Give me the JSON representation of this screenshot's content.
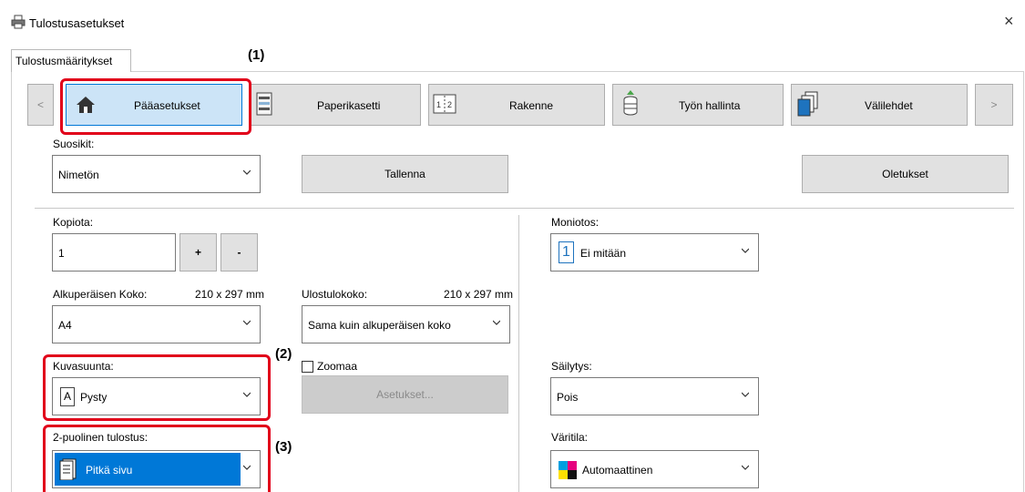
{
  "window": {
    "title": "Tulostusasetukset",
    "close_glyph": "×"
  },
  "tabs": [
    {
      "label": "Tulostusmääritykset"
    }
  ],
  "nav": {
    "prev_glyph": "<",
    "next_glyph": ">",
    "items": [
      {
        "label": "Pääasetukset",
        "icon": "home-icon"
      },
      {
        "label": "Paperikasetti",
        "icon": "paper-tray-icon"
      },
      {
        "label": "Rakenne",
        "icon": "layout-icon"
      },
      {
        "label": "Työn hallinta",
        "icon": "job-storage-icon"
      },
      {
        "label": "Välilehdet",
        "icon": "tab-pages-icon"
      }
    ]
  },
  "favorites": {
    "label": "Suosikit:",
    "value": "Nimetön",
    "save_label": "Tallenna",
    "defaults_label": "Oletukset"
  },
  "copies": {
    "label": "Kopiota:",
    "value": "1",
    "plus": "+",
    "minus": "-"
  },
  "original_size": {
    "label": "Alkuperäisen Koko:",
    "dims": "210 x 297 mm",
    "value": "A4"
  },
  "output_size": {
    "label": "Ulostulokoko:",
    "dims": "210 x 297 mm",
    "value": "Sama kuin alkuperäisen koko"
  },
  "orientation": {
    "label": "Kuvasuunta:",
    "value": "Pysty",
    "icon_glyph": "A"
  },
  "zoom": {
    "label": "Zoomaa",
    "settings_label": "Asetukset..."
  },
  "duplex": {
    "label": "2-puolinen tulostus:",
    "value": "Pitkä sivu"
  },
  "nup": {
    "label": "Moniotos:",
    "value": "Ei mitään",
    "icon_glyph": "1"
  },
  "retention": {
    "label": "Säilytys:",
    "value": "Pois"
  },
  "color_mode": {
    "label": "Väritila:",
    "value": "Automaattinen"
  },
  "callouts": {
    "c1": "(1)",
    "c2": "(2)",
    "c3": "(3)"
  },
  "colors": {
    "highlight_red": "#e1001a",
    "selection_blue": "#0078d7",
    "active_tab_bg": "#cce4f7"
  }
}
